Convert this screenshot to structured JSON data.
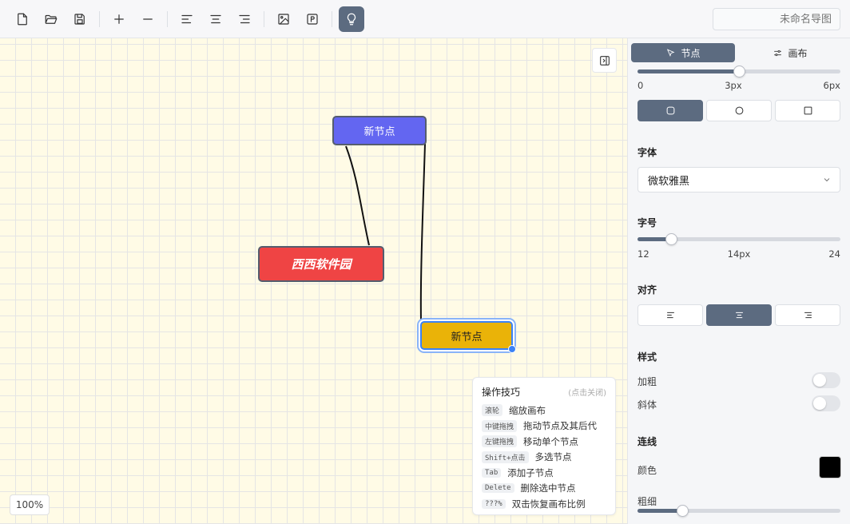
{
  "toolbar": {
    "buttons": [
      {
        "name": "new-file-icon"
      },
      {
        "name": "open-folder-icon"
      },
      {
        "name": "save-icon"
      },
      {
        "name": "add-icon"
      },
      {
        "name": "remove-icon"
      },
      {
        "name": "align-left-icon"
      },
      {
        "name": "align-center-icon"
      },
      {
        "name": "align-right-icon"
      },
      {
        "name": "image-icon"
      },
      {
        "name": "presentation-icon"
      },
      {
        "name": "lightbulb-icon"
      }
    ],
    "title_placeholder": "未命名导图"
  },
  "canvas": {
    "nodes": {
      "blue": {
        "label": "新节点",
        "color": "#6366f1"
      },
      "red": {
        "label": "西西软件园",
        "color": "#ef4444"
      },
      "yellow": {
        "label": "新节点",
        "color": "#eab308"
      }
    },
    "zoom": "100%"
  },
  "tips": {
    "title": "操作技巧",
    "close_hint": "(点击关闭)",
    "items": [
      {
        "key": "滚轮",
        "desc": "缩放画布"
      },
      {
        "key": "中键拖拽",
        "desc": "拖动节点及其后代"
      },
      {
        "key": "左键拖拽",
        "desc": "移动单个节点"
      },
      {
        "key": "Shift+点击",
        "desc": "多选节点"
      },
      {
        "key": "Tab",
        "desc": "添加子节点"
      },
      {
        "key": "Delete",
        "desc": "删除选中节点"
      },
      {
        "key": "???%",
        "desc": "双击恢复画布比例"
      }
    ]
  },
  "panel": {
    "tabs": {
      "node": "节点",
      "canvas": "画布"
    },
    "border_width": {
      "min": "0",
      "value_label": "3px",
      "max": "6px",
      "fraction": 0.5
    },
    "shapes": [
      "rounded-rect-icon",
      "circle-icon",
      "square-icon"
    ],
    "font": {
      "title": "字体",
      "value": "微软雅黑"
    },
    "font_size": {
      "title": "字号",
      "min": "12",
      "value_label": "14px",
      "max": "24",
      "fraction": 0.1667
    },
    "align": {
      "title": "对齐"
    },
    "style": {
      "title": "样式",
      "bold": "加粗",
      "italic": "斜体"
    },
    "line": {
      "title": "连线",
      "color_label": "颜色",
      "color": "#000000",
      "width_label": "粗细",
      "width_fraction": 0.22
    }
  }
}
